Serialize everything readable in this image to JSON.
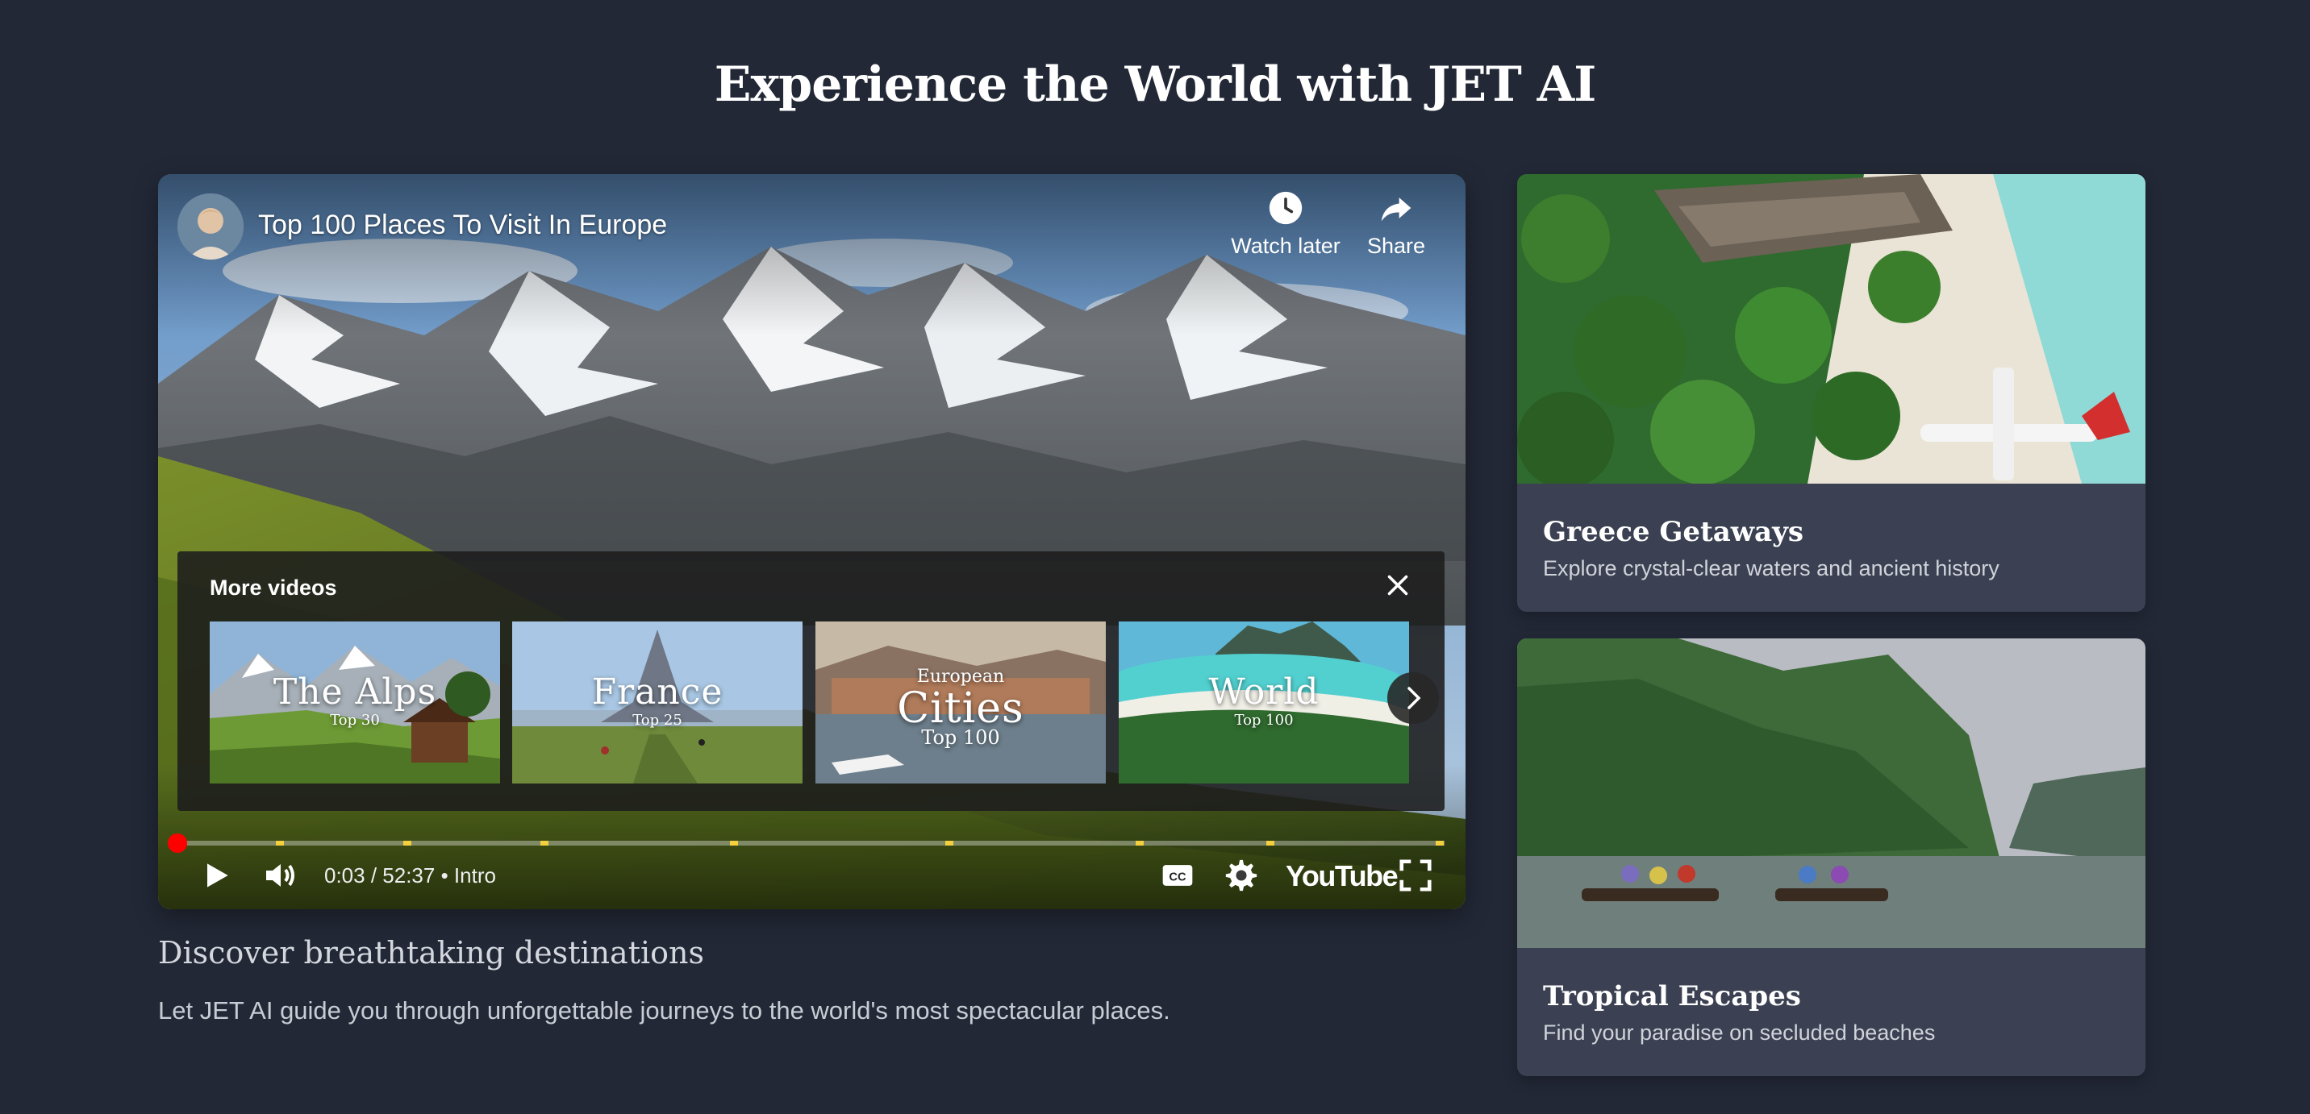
{
  "page": {
    "title": "Experience the World with JET AI"
  },
  "video": {
    "title": "Top 100 Places To Visit In Europe",
    "watch_later_label": "Watch later",
    "share_label": "Share",
    "more_videos": {
      "title": "More videos",
      "thumbnails": [
        {
          "big": "The Alps",
          "sub": "Top 30"
        },
        {
          "big": "France",
          "sub": "Top 25"
        },
        {
          "pre": "European",
          "big": "Cities",
          "sub": "Top 100"
        },
        {
          "big": "World",
          "sub": "Top 100"
        }
      ]
    },
    "time": "0:03 / 52:37",
    "chapter": "Intro",
    "logo": "YouTube",
    "progress_fraction": 0.001
  },
  "section": {
    "heading": "Discover breathtaking destinations",
    "text": "Let JET AI guide you through unforgettable journeys to the world's most spectacular places."
  },
  "cards": [
    {
      "title": "Greece Getaways",
      "description": "Explore crystal-clear waters and ancient history"
    },
    {
      "title": "Tropical Escapes",
      "description": "Find your paradise on secluded beaches"
    }
  ],
  "icons": {
    "watch_later": "clock-icon",
    "share": "share-arrow-icon",
    "close": "close-icon",
    "next": "chevron-right-icon",
    "play": "play-icon",
    "volume": "volume-icon",
    "captions": "cc-icon",
    "settings": "gear-icon",
    "fullscreen": "fullscreen-icon"
  },
  "colors": {
    "background": "#222836",
    "card": "#3b4152",
    "progress_played": "#ff0000",
    "chapter_marker": "#f4d03f"
  }
}
